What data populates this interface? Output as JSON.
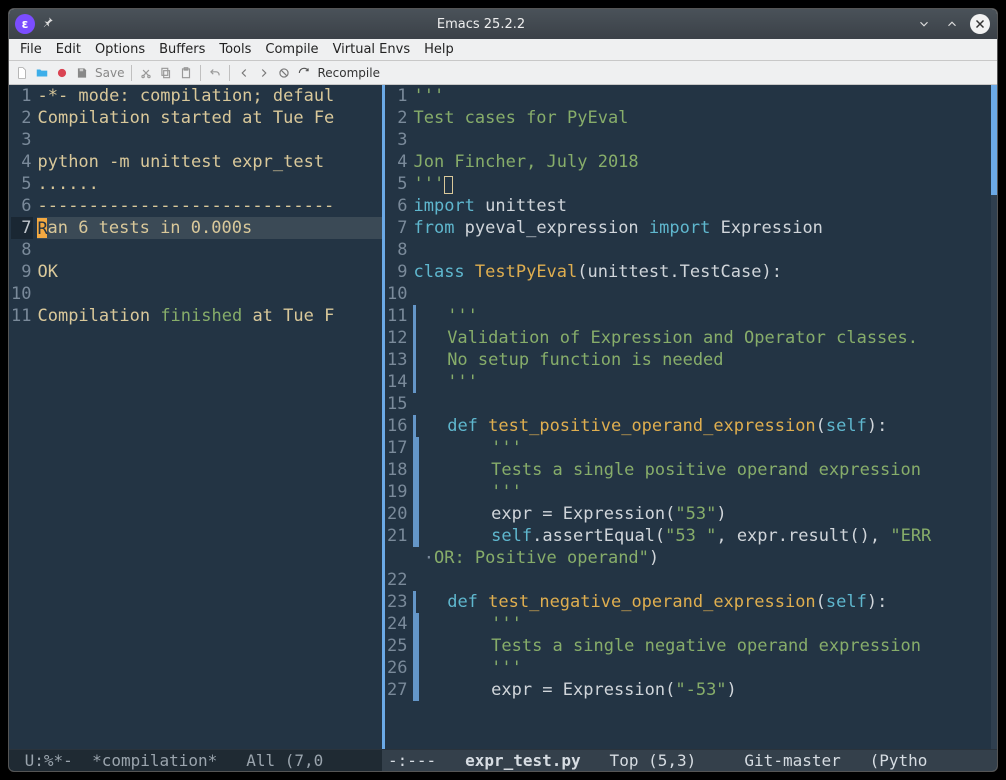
{
  "titlebar": {
    "title": "Emacs 25.2.2",
    "app_glyph": "ε"
  },
  "menubar": {
    "items": [
      "File",
      "Edit",
      "Options",
      "Buffers",
      "Tools",
      "Compile",
      "Virtual Envs",
      "Help"
    ]
  },
  "toolbar": {
    "save_label": "Save",
    "recompile_label": "Recompile"
  },
  "left_pane": {
    "lines": [
      {
        "n": 1,
        "segs": [
          {
            "t": "-*- mode: compilation; defaul",
            "c": "c-gut"
          }
        ]
      },
      {
        "n": 2,
        "segs": [
          {
            "t": "Compilation started at Tue Fe",
            "c": "c-gut"
          }
        ]
      },
      {
        "n": 3,
        "segs": []
      },
      {
        "n": 4,
        "segs": [
          {
            "t": "python -m unittest expr_test",
            "c": "c-gut"
          }
        ]
      },
      {
        "n": 5,
        "segs": [
          {
            "t": "......",
            "c": "c-gut"
          }
        ]
      },
      {
        "n": 6,
        "segs": [
          {
            "t": "-----------------------------",
            "c": "c-gut"
          }
        ]
      },
      {
        "n": 7,
        "hl": true,
        "cursor": true,
        "segs": [
          {
            "t": "an 6 tests in 0.000s",
            "c": "c-gut"
          }
        ]
      },
      {
        "n": 8,
        "segs": []
      },
      {
        "n": 9,
        "segs": [
          {
            "t": "OK",
            "c": "c-gut"
          }
        ]
      },
      {
        "n": 10,
        "segs": []
      },
      {
        "n": 11,
        "segs": [
          {
            "t": "Compilation ",
            "c": "c-gut"
          },
          {
            "t": "finished",
            "c": "c-str"
          },
          {
            "t": " at Tue F",
            "c": "c-gut"
          }
        ]
      }
    ]
  },
  "right_pane": {
    "lines": [
      {
        "n": 1,
        "segs": [
          {
            "t": "'''",
            "c": "c-str"
          }
        ]
      },
      {
        "n": 2,
        "segs": [
          {
            "t": "Test cases for PyEval",
            "c": "c-str"
          }
        ]
      },
      {
        "n": 3,
        "segs": []
      },
      {
        "n": 4,
        "segs": [
          {
            "t": "Jon Fincher, July 2018",
            "c": "c-str"
          }
        ]
      },
      {
        "n": 5,
        "segs": [
          {
            "t": "'''",
            "c": "c-str"
          }
        ],
        "outline_cursor": true
      },
      {
        "n": 6,
        "segs": [
          {
            "t": "import",
            "c": "c-kw"
          },
          {
            "t": " unittest",
            "c": "c-plain"
          }
        ]
      },
      {
        "n": 7,
        "segs": [
          {
            "t": "from",
            "c": "c-kw"
          },
          {
            "t": " pyeval_expression ",
            "c": "c-plain"
          },
          {
            "t": "import",
            "c": "c-kw"
          },
          {
            "t": " Expression",
            "c": "c-plain"
          }
        ]
      },
      {
        "n": 8,
        "segs": []
      },
      {
        "n": 9,
        "segs": [
          {
            "t": "class ",
            "c": "c-kw"
          },
          {
            "t": "TestPyEval",
            "c": "c-fn"
          },
          {
            "t": "(unittest.TestCase):",
            "c": "c-plain"
          }
        ]
      },
      {
        "n": 10,
        "segs": []
      },
      {
        "n": 11,
        "indent": 1,
        "segs": [
          {
            "t": "   '''",
            "c": "c-str"
          }
        ]
      },
      {
        "n": 12,
        "indent": 1,
        "segs": [
          {
            "t": "   Validation of Expression and Operator classes.",
            "c": "c-str"
          }
        ]
      },
      {
        "n": 13,
        "indent": 1,
        "segs": [
          {
            "t": "   No setup function is needed",
            "c": "c-str"
          }
        ]
      },
      {
        "n": 14,
        "indent": 1,
        "segs": [
          {
            "t": "   '''",
            "c": "c-str"
          }
        ]
      },
      {
        "n": 15,
        "segs": []
      },
      {
        "n": 16,
        "indent": 1,
        "segs": [
          {
            "t": "   ",
            "c": ""
          },
          {
            "t": "def ",
            "c": "c-kw"
          },
          {
            "t": "test_positive_operand_expression",
            "c": "c-fn"
          },
          {
            "t": "(",
            "c": "c-plain"
          },
          {
            "t": "self",
            "c": "c-kw"
          },
          {
            "t": "):",
            "c": "c-plain"
          }
        ]
      },
      {
        "n": 17,
        "indent": 2,
        "segs": [
          {
            "t": "       '''",
            "c": "c-str"
          }
        ]
      },
      {
        "n": 18,
        "indent": 2,
        "segs": [
          {
            "t": "       Tests a single positive operand expression",
            "c": "c-str"
          }
        ]
      },
      {
        "n": 19,
        "indent": 2,
        "segs": [
          {
            "t": "       '''",
            "c": "c-str"
          }
        ]
      },
      {
        "n": 20,
        "indent": 2,
        "segs": [
          {
            "t": "       expr = Expression(",
            "c": "c-plain"
          },
          {
            "t": "\"53\"",
            "c": "c-str"
          },
          {
            "t": ")",
            "c": "c-plain"
          }
        ]
      },
      {
        "n": 21,
        "indent": 2,
        "segs": [
          {
            "t": "       ",
            "c": ""
          },
          {
            "t": "self",
            "c": "c-kw"
          },
          {
            "t": ".assertEqual(",
            "c": "c-plain"
          },
          {
            "t": "\"53 \"",
            "c": "c-str"
          },
          {
            "t": ", expr.result(), ",
            "c": "c-plain"
          },
          {
            "t": "\"ERR",
            "c": "c-str"
          }
        ]
      },
      {
        "wrap": true,
        "segs": [
          {
            "t": "OR: Positive operand\"",
            "c": "c-str"
          },
          {
            "t": ")",
            "c": "c-plain"
          }
        ]
      },
      {
        "n": 22,
        "segs": []
      },
      {
        "n": 23,
        "indent": 1,
        "segs": [
          {
            "t": "   ",
            "c": ""
          },
          {
            "t": "def ",
            "c": "c-kw"
          },
          {
            "t": "test_negative_operand_expression",
            "c": "c-fn"
          },
          {
            "t": "(",
            "c": "c-plain"
          },
          {
            "t": "self",
            "c": "c-kw"
          },
          {
            "t": "):",
            "c": "c-plain"
          }
        ]
      },
      {
        "n": 24,
        "indent": 2,
        "segs": [
          {
            "t": "       '''",
            "c": "c-str"
          }
        ]
      },
      {
        "n": 25,
        "indent": 2,
        "segs": [
          {
            "t": "       Tests a single negative operand expression",
            "c": "c-str"
          }
        ]
      },
      {
        "n": 26,
        "indent": 2,
        "segs": [
          {
            "t": "       '''",
            "c": "c-str"
          }
        ]
      },
      {
        "n": 27,
        "indent": 2,
        "segs": [
          {
            "t": "       expr = Expression(",
            "c": "c-plain"
          },
          {
            "t": "\"-53\"",
            "c": "c-str"
          },
          {
            "t": ")",
            "c": "c-plain"
          }
        ]
      }
    ]
  },
  "modeline_left": " U:%*-  *compilation*   All (7,0",
  "modeline_right_prefix": "-:---   ",
  "modeline_right_name": "expr_test.py",
  "modeline_right_suffix": "   Top (5,3)     Git-master   (Pytho"
}
